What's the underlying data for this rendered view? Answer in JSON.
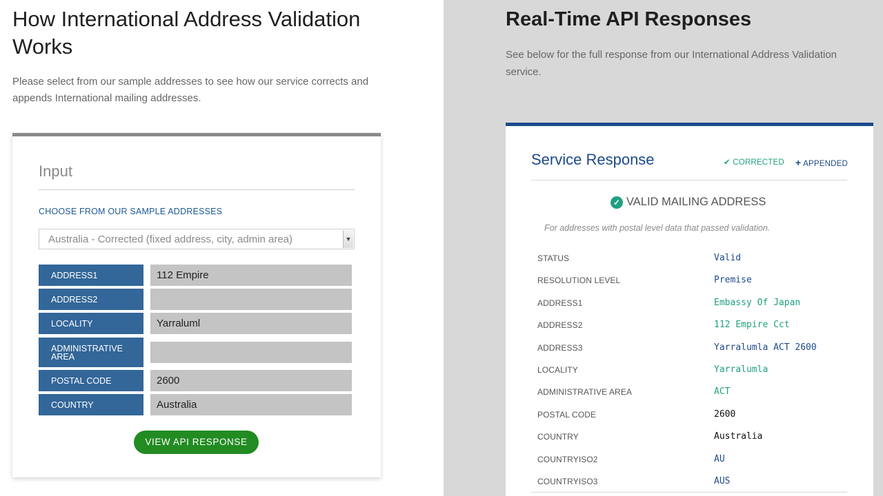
{
  "left": {
    "title": "How International Address Validation Works",
    "description": "Please select from our sample addresses to see how our service corrects and appends International mailing addresses.",
    "input": {
      "title": "Input",
      "sample_label": "CHOOSE FROM OUR SAMPLE ADDRESSES",
      "selected_sample": "Australia - Corrected (fixed address, city, admin area)",
      "fields": [
        {
          "label": "ADDRESS1",
          "value": ""
        },
        {
          "label": "ADDRESS2",
          "value": ""
        },
        {
          "label": "LOCALITY",
          "value": "Yarraluml"
        },
        {
          "label": "ADMINISTRATIVE AREA",
          "value": ""
        },
        {
          "label": "POSTAL CODE",
          "value": "2600"
        },
        {
          "label": "COUNTRY",
          "value": "Australia"
        }
      ],
      "address1_value": "112 Empire",
      "button_label": "VIEW API RESPONSE"
    }
  },
  "right": {
    "title": "Real-Time API Responses",
    "description": "See below for the full response from our International Address Validation service.",
    "response": {
      "title": "Service Response",
      "tag_corrected": "CORRECTED",
      "tag_appended": "APPENDED",
      "valid_heading": "VALID MAILING ADDRESS",
      "valid_note": "For addresses with postal level data that passed validation.",
      "rows": [
        {
          "key": "STATUS",
          "value": "Valid",
          "color": "#1d4a8a"
        },
        {
          "key": "RESOLUTION LEVEL",
          "value": "Premise",
          "color": "#1d4a8a"
        },
        {
          "key": "ADDRESS1",
          "value": "Embassy Of Japan",
          "color": "#20a080"
        },
        {
          "key": "ADDRESS2",
          "value": "112 Empire Cct",
          "color": "#20a080"
        },
        {
          "key": "ADDRESS3",
          "value": "Yarralumla ACT 2600",
          "color": "#1d4a8a"
        },
        {
          "key": "LOCALITY",
          "value": "Yarralumla",
          "color": "#20a080"
        },
        {
          "key": "ADMINISTRATIVE AREA",
          "value": "ACT",
          "color": "#20a080"
        },
        {
          "key": "POSTAL CODE",
          "value": "2600",
          "color": "#111111"
        },
        {
          "key": "COUNTRY",
          "value": "Australia",
          "color": "#111111"
        },
        {
          "key": "COUNTRYISO2",
          "value": "AU",
          "color": "#1d4a8a"
        },
        {
          "key": "COUNTRYISO3",
          "value": "AUS",
          "color": "#1d4a8a"
        }
      ]
    }
  },
  "icons": {
    "corrected": "check-icon",
    "appended": "plus-icon",
    "valid": "check-circle-icon",
    "select": "chevron-down-icon"
  }
}
